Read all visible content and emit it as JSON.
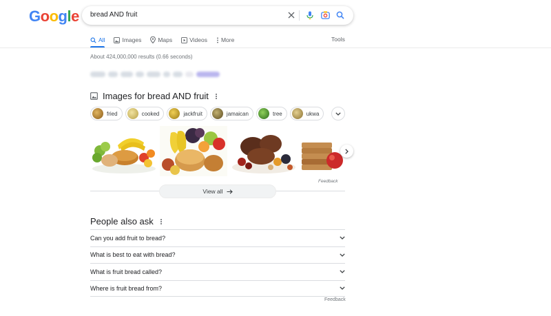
{
  "logo": {
    "letters": [
      "G",
      "o",
      "o",
      "g",
      "l",
      "e"
    ]
  },
  "search": {
    "query": "bread AND fruit"
  },
  "tabs": [
    {
      "label": "All",
      "icon": "search-icon"
    },
    {
      "label": "Images",
      "icon": "image-icon"
    },
    {
      "label": "Maps",
      "icon": "map-pin-icon"
    },
    {
      "label": "Videos",
      "icon": "video-icon"
    },
    {
      "label": "More",
      "icon": "kebab-icon"
    }
  ],
  "tools_label": "Tools",
  "result_stats": "About 424,000,000 results (0.66 seconds)",
  "images_section": {
    "title": "Images for bread AND fruit",
    "chips": [
      {
        "label": "fried",
        "color": "#a8741f"
      },
      {
        "label": "cooked",
        "color": "#d9c466"
      },
      {
        "label": "jackfruit",
        "color": "#c9a42a"
      },
      {
        "label": "jamaican",
        "color": "#8a7a3a"
      },
      {
        "label": "tree",
        "color": "#3f8a2a"
      },
      {
        "label": "ukwa",
        "color": "#b59a4a"
      }
    ],
    "feedback": "Feedback",
    "view_all": "View all"
  },
  "people_also_ask": {
    "title": "People also ask",
    "questions": [
      "Can you add fruit to bread?",
      "What is best to eat with bread?",
      "What is fruit bread called?",
      "Where is fruit bread from?"
    ],
    "feedback": "Feedback"
  },
  "colors": {
    "accent": "#1a73e8",
    "text": "#202124",
    "muted": "#70757a"
  }
}
